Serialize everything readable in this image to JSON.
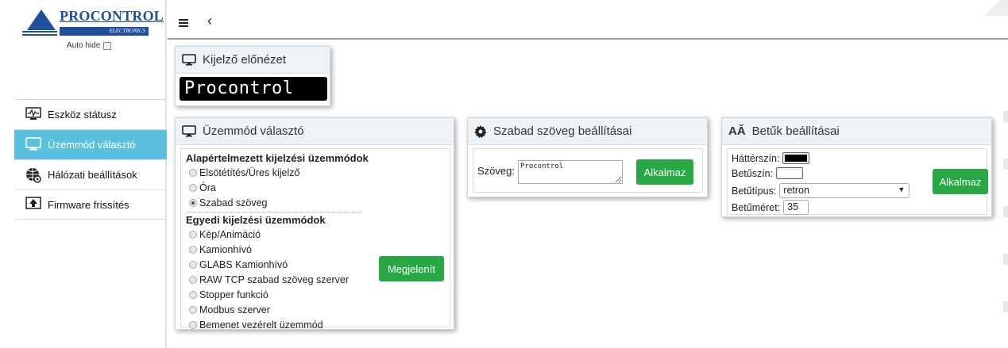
{
  "brand": {
    "name": "PROCONTROL",
    "tagline": "ELECTRONICS"
  },
  "sidebar": {
    "autohide_label": "Auto hide",
    "items": [
      {
        "label": "Eszköz státusz",
        "icon": "monitor-pulse-icon",
        "active": false
      },
      {
        "label": "Üzemmód választó",
        "icon": "monitor-icon",
        "active": true
      },
      {
        "label": "Hálózati beállítások",
        "icon": "globe-gear-icon",
        "active": false
      },
      {
        "label": "Firmware frissítés",
        "icon": "upload-icon",
        "active": false
      }
    ]
  },
  "topbar": {
    "back_glyph": "‹"
  },
  "preview": {
    "title": "Kijelző előnézet",
    "display_text": "Procontrol"
  },
  "mode": {
    "title": "Üzemmód választó",
    "default_group": "Alapértelmezett kijelzési üzemmódok",
    "default_options": [
      "Elsötétítés/Üres kijelző",
      "Óra",
      "Szabad szöveg"
    ],
    "selected": "Szabad szöveg",
    "custom_group": "Egyedi kijelzési üzemmódok",
    "custom_options": [
      "Kép/Animáció",
      "Kamionhívó",
      "GLABS Kamionhívó",
      "RAW TCP szabad szöveg szerver",
      "Stopper funkció",
      "Modbus szerver",
      "Bemenet vezérelt üzemmód"
    ],
    "button": "Megjelenít"
  },
  "free_text": {
    "title": "Szabad szöveg beállításai",
    "label": "Szöveg:",
    "value": "Procontrol",
    "button": "Alkalmaz"
  },
  "font_settings": {
    "title_prefix": "AĂ",
    "title": "Betűk beállításai",
    "bg_label": "Háttérszín:",
    "bg_color": "#000000",
    "fg_label": "Betűszín:",
    "fg_color": "#ffffff",
    "font_label": "Betűtípus:",
    "font_value": "retron",
    "size_label": "Betűméret:",
    "size_value": "35",
    "button": "Alkalmaz"
  }
}
